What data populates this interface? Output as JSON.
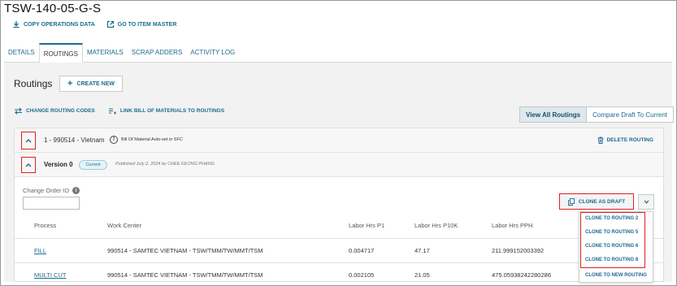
{
  "item": {
    "title": "TSW-140-05-G-S"
  },
  "top_actions": [
    {
      "label": "COPY OPERATIONS DATA",
      "icon": "download-icon"
    },
    {
      "label": "GO TO ITEM MASTER",
      "icon": "external-link-icon"
    }
  ],
  "tabs": [
    {
      "label": "DETAILS",
      "active": false
    },
    {
      "label": "ROUTINGS",
      "active": true
    },
    {
      "label": "MATERIALS",
      "active": false
    },
    {
      "label": "SCRAP ADDERS",
      "active": false
    },
    {
      "label": "ACTIVITY LOG",
      "active": false
    }
  ],
  "routings": {
    "title": "Routings",
    "create_label": "CREATE NEW",
    "change_codes_label": "CHANGE ROUTING CODES",
    "link_bom_label": "LINK BILL OF MATERIALS TO ROUTINGS",
    "view_all_label": "View All Routings",
    "compare_label": "Compare Draft To Current"
  },
  "routing": {
    "name": "1 - 990514 - Vietnam",
    "bom_note": "Bill Of Material Auto-set in SFC",
    "delete_label": "DELETE ROUTING"
  },
  "version": {
    "label": "Version 0",
    "badge": "Current",
    "published": "Published July 2, 2024 by CHEE KEONG PHANG"
  },
  "change_order": {
    "label": "Change Order ID",
    "value": ""
  },
  "clone": {
    "label": "CLONE AS DRAFT",
    "menu": [
      "CLONE TO ROUTING 2",
      "CLONE TO ROUTING 5",
      "CLONE TO ROUTING 6",
      "CLONE TO ROUTING 8",
      "CLONE TO NEW ROUTING"
    ]
  },
  "table": {
    "headers": [
      "Process",
      "Work Center",
      "Labor Hrs P1",
      "Labor Hrs P10K",
      "Labor Hrs PPH"
    ],
    "rows": [
      [
        "FILL",
        "990514 - SAMTEC VIETNAM - TSW/TMM/TW/MMT/TSM",
        "0.004717",
        "47.17",
        "211.999152003392"
      ],
      [
        "MULTI CUT",
        "990514 - SAMTEC VIETNAM - TSW/TMM/TW/MMT/TSM",
        "0.002105",
        "21.05",
        "475.05938242280286"
      ]
    ]
  },
  "colors": {
    "accent": "#1d6b8f",
    "highlight": "#e02020",
    "panel_bg": "#f2f2f2"
  }
}
